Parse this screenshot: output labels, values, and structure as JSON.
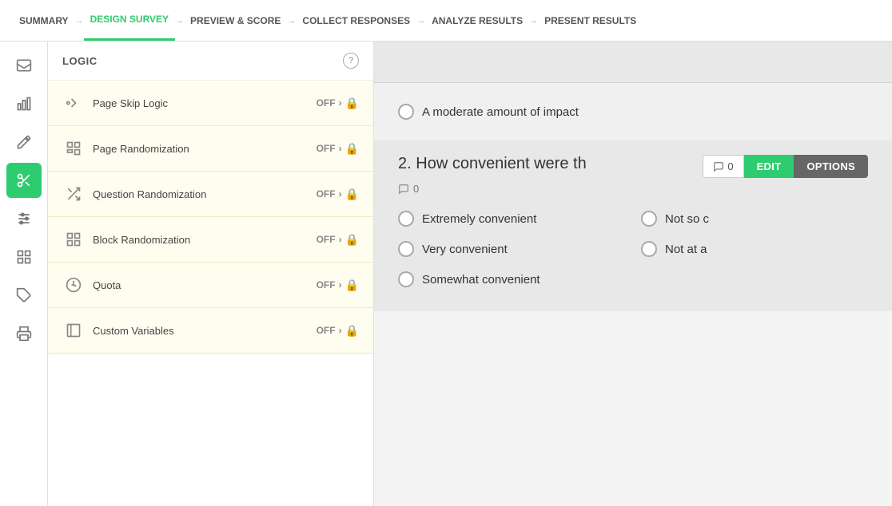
{
  "nav": {
    "items": [
      {
        "id": "summary",
        "label": "SUMMARY",
        "active": false
      },
      {
        "id": "design-survey",
        "label": "DESIGN SURVEY",
        "active": true
      },
      {
        "id": "preview-score",
        "label": "PREVIEW & SCORE",
        "active": false
      },
      {
        "id": "collect-responses",
        "label": "COLLECT RESPONSES",
        "active": false
      },
      {
        "id": "analyze-results",
        "label": "ANALYZE RESULTS",
        "active": false
      },
      {
        "id": "present-results",
        "label": "PRESENT RESULTS",
        "active": false
      }
    ]
  },
  "logic_panel": {
    "title": "LOGIC",
    "help_label": "?",
    "items": [
      {
        "id": "page-skip-logic",
        "label": "Page Skip Logic",
        "status": "OFF",
        "icon": "skip"
      },
      {
        "id": "page-randomization",
        "label": "Page Randomization",
        "status": "OFF",
        "icon": "randomize"
      },
      {
        "id": "question-randomization",
        "label": "Question Randomization",
        "status": "OFF",
        "icon": "shuffle"
      },
      {
        "id": "block-randomization",
        "label": "Block Randomization",
        "status": "OFF",
        "icon": "block"
      },
      {
        "id": "quota",
        "label": "Quota",
        "status": "OFF",
        "icon": "quota"
      },
      {
        "id": "custom-variables",
        "label": "Custom Variables",
        "status": "OFF",
        "icon": "variables"
      }
    ]
  },
  "sidebar_icons": [
    {
      "id": "inbox",
      "icon": "inbox",
      "active": false
    },
    {
      "id": "chart",
      "icon": "chart",
      "active": false
    },
    {
      "id": "pencil",
      "icon": "pencil",
      "active": false
    },
    {
      "id": "logic",
      "icon": "scissors",
      "active": true
    },
    {
      "id": "sliders",
      "icon": "sliders",
      "active": false
    },
    {
      "id": "grid",
      "icon": "grid",
      "active": false
    },
    {
      "id": "tag",
      "icon": "tag",
      "active": false
    },
    {
      "id": "print",
      "icon": "print",
      "active": false
    }
  ],
  "survey": {
    "q1_option": "A moderate amount of impact",
    "q2": {
      "number": "2.",
      "title": "How convenient were th",
      "comment_count": "0",
      "comment_count_label": "0",
      "edit_label": "EDIT",
      "options_label": "OPTIONS",
      "options": [
        {
          "col": 0,
          "text": "Extremely convenient"
        },
        {
          "col": 1,
          "text": "Not so c"
        },
        {
          "col": 0,
          "text": "Very convenient"
        },
        {
          "col": 1,
          "text": "Not at a"
        },
        {
          "col": 0,
          "text": "Somewhat convenient"
        }
      ]
    }
  }
}
